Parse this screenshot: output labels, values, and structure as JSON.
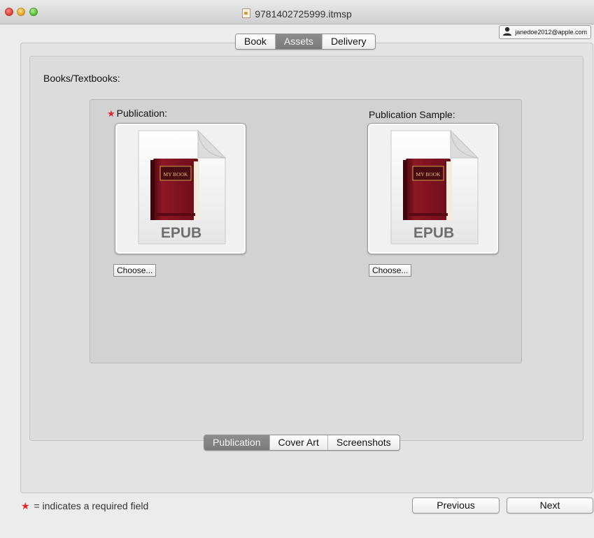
{
  "window": {
    "title": "9781402725999.itmsp"
  },
  "user": {
    "email": "janedoe2012@apple.com"
  },
  "top_tabs": [
    {
      "label": "Book",
      "active": false
    },
    {
      "label": "Assets",
      "active": true
    },
    {
      "label": "Delivery",
      "active": false
    }
  ],
  "section": {
    "label": "Books/Textbooks:"
  },
  "publication": {
    "label": "Publication:",
    "required_marker": "★",
    "file_badge": "EPUB",
    "book_title": "MY BOOK",
    "choose_label": "Choose..."
  },
  "sample": {
    "label": "Publication Sample:",
    "file_badge": "EPUB",
    "book_title": "MY BOOK",
    "choose_label": "Choose..."
  },
  "bottom_tabs": [
    {
      "label": "Publication",
      "active": true
    },
    {
      "label": "Cover Art",
      "active": false
    },
    {
      "label": "Screenshots",
      "active": false
    }
  ],
  "footer": {
    "required_marker": "★",
    "required_note": "= indicates a required field",
    "previous_label": "Previous",
    "next_label": "Next"
  },
  "colors": {
    "required": "#e0252b",
    "active_tab": "#808080",
    "book": "#7a0f1c"
  },
  "icons": [
    "close-window-icon",
    "minimize-window-icon",
    "zoom-window-icon",
    "document-icon",
    "user-icon",
    "epub-file-icon"
  ]
}
